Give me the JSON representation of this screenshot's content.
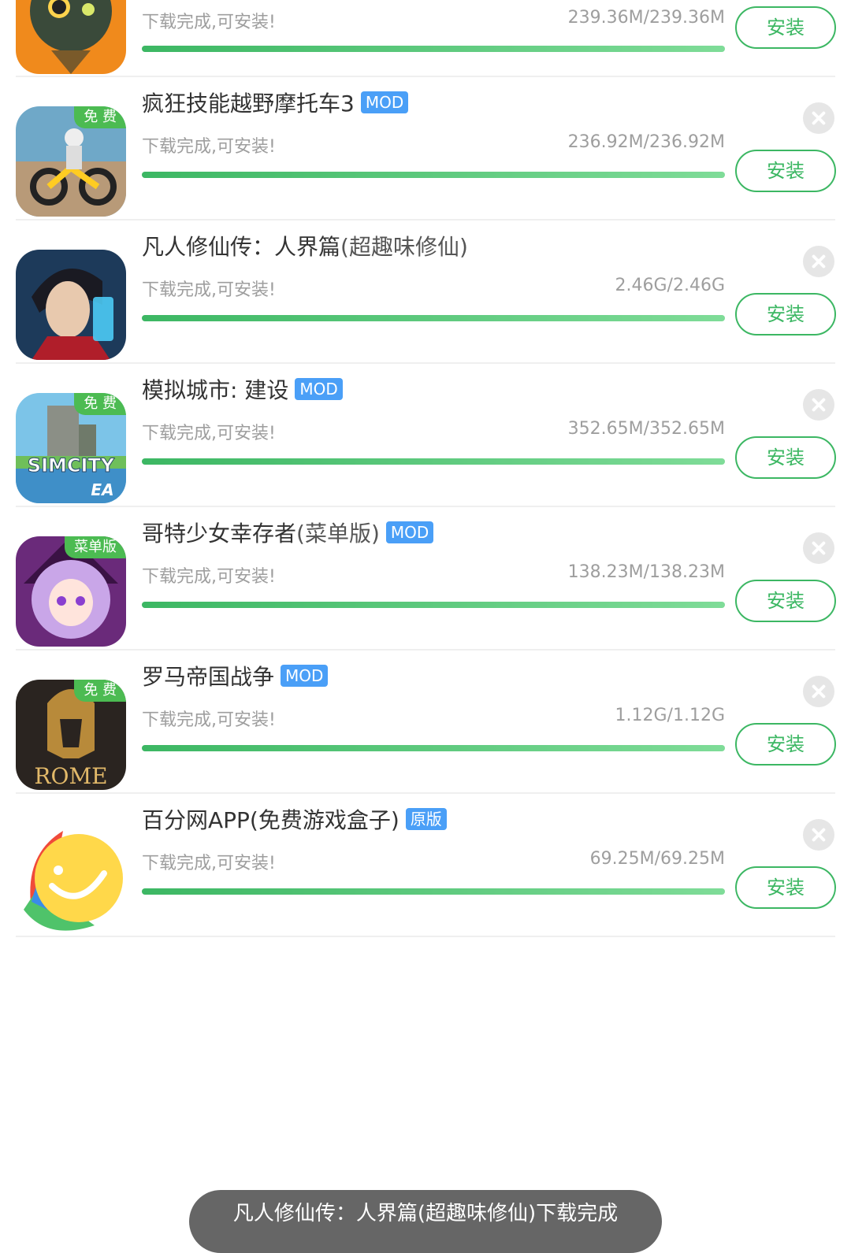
{
  "accent": "#3cb763",
  "items": [
    {
      "title": "",
      "subtitle": "",
      "tag": "",
      "badge": "",
      "status": "下载完成,可安装!",
      "size": "239.36M/239.36M",
      "progress": 1.0,
      "install": "安装",
      "icon": "cat-detective-icon"
    },
    {
      "title": "疯狂技能越野摩托车3",
      "subtitle": "",
      "tag": "MOD",
      "badge": "免 费",
      "status": "下载完成,可安装!",
      "size": "236.92M/236.92M",
      "progress": 1.0,
      "install": "安装",
      "icon": "motocross-icon"
    },
    {
      "title": "凡人修仙传：人界篇",
      "subtitle": "(超趣味修仙)",
      "tag": "",
      "badge": "",
      "status": "下载完成,可安装!",
      "size": "2.46G/2.46G",
      "progress": 1.0,
      "install": "安装",
      "icon": "cultivator-hero-icon"
    },
    {
      "title": "模拟城市: 建设",
      "subtitle": "",
      "tag": "MOD",
      "badge": "免 费",
      "status": "下载完成,可安装!",
      "size": "352.65M/352.65M",
      "progress": 1.0,
      "install": "安装",
      "icon": "simcity-icon",
      "icon_text": "SIMCITY",
      "icon_brand": "EA"
    },
    {
      "title": "哥特少女幸存者",
      "subtitle": "(菜单版)",
      "tag": "MOD",
      "badge": "菜单版",
      "status": "下载完成,可安装!",
      "size": "138.23M/138.23M",
      "progress": 1.0,
      "install": "安装",
      "icon": "gothic-girl-icon"
    },
    {
      "title": "罗马帝国战争",
      "subtitle": "",
      "tag": "MOD",
      "badge": "免 费",
      "status": "下载完成,可安装!",
      "size": "1.12G/1.12G",
      "progress": 1.0,
      "install": "安装",
      "icon": "rome-helmet-icon",
      "icon_text": "ROME"
    },
    {
      "title": "百分网APP(免费游戏盒子)",
      "subtitle": "",
      "tag": "原版",
      "badge": "",
      "status": "下载完成,可安装!",
      "size": "69.25M/69.25M",
      "progress": 1.0,
      "install": "安装",
      "icon": "smiley-app-icon"
    }
  ],
  "toast": "凡人修仙传：人界篇(超趣味修仙)下载完成"
}
